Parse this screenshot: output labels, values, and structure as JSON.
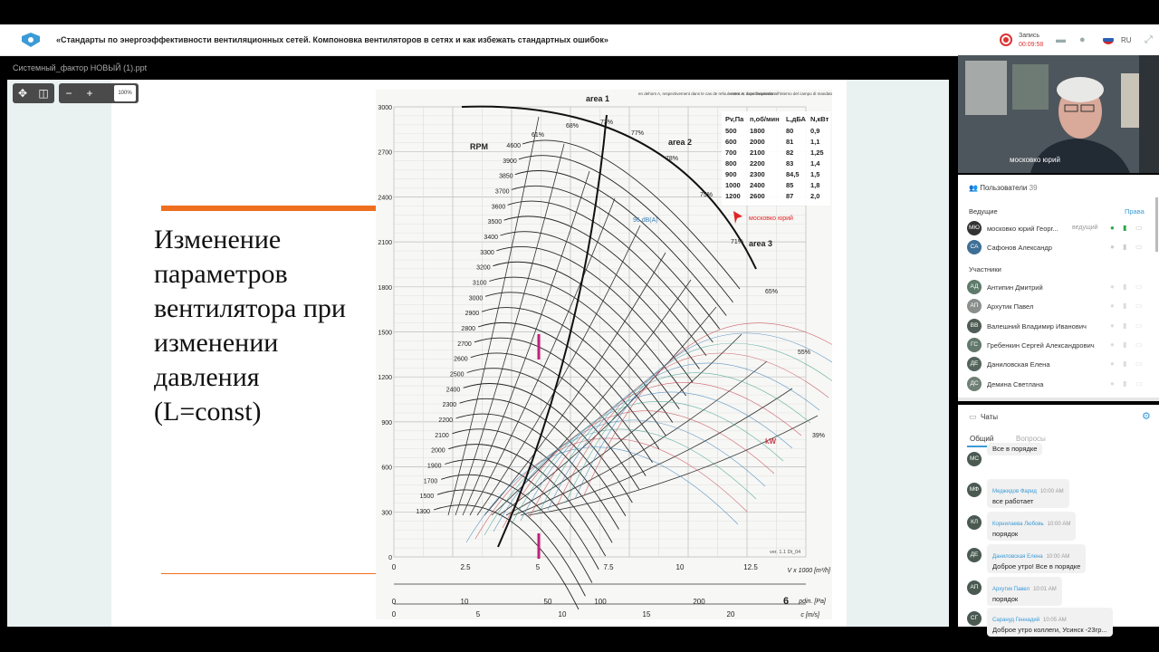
{
  "meeting": {
    "title": "«Стандарты по энергоэффективности вентиляционных сетей. Компоновка вентиляторов в сетях и как избежать стандартных ошибок»",
    "record_label": "Запись",
    "record_time": "00:09:58",
    "language": "RU"
  },
  "presentation": {
    "file_name": "Системный_фактор НОВЫЙ (1).ppt",
    "zoom": "100%",
    "slide_title": "Изменение параметров вентилятора при изменении давления (L=const)"
  },
  "chart_data": {
    "type": "line",
    "title": "",
    "y_ticks": [
      "3000",
      "2700",
      "2400",
      "2100",
      "1800",
      "1500",
      "1200",
      "900",
      "600",
      "300",
      "0"
    ],
    "x_ticks": [
      "0",
      "2.5",
      "5",
      "7.5",
      "10",
      "12.5"
    ],
    "x_unit": "V x 1000 [m³/h]",
    "pdin_ticks": [
      "0",
      "10",
      "50",
      "100",
      "200",
      "6"
    ],
    "pdin_unit": "pdin. [Pa]",
    "c_ticks": [
      "0",
      "5",
      "10",
      "15",
      "20"
    ],
    "c_unit": "c [m/s]",
    "rpm_label": "RPM",
    "rpm_values": [
      "4600",
      "3900",
      "3850",
      "3700",
      "3600",
      "3500",
      "3400",
      "3300",
      "3200",
      "3100",
      "3000",
      "2900",
      "2800",
      "2700",
      "2600",
      "2500",
      "2400",
      "2300",
      "2200",
      "2100",
      "2000",
      "1900",
      "1700",
      "1500",
      "1300"
    ],
    "efficiency_labels": [
      "61%",
      "68%",
      "73%",
      "77%",
      "78%",
      "75%",
      "71%",
      "65%",
      "55%",
      "39%"
    ],
    "area_labels": [
      "area 1",
      "area 2",
      "area 3"
    ],
    "kw_label": "kW",
    "sound_label": "96 dB(A)",
    "version_text": "ver. 1.1 Dt_04",
    "header_notes": [
      "en dehors A, respectivement dans le cas de refoulement et dans l'aspiration",
      "entro A, rispettivamente all'interno del campo di mandata e alla bocca di aspirazione"
    ],
    "table": {
      "headers": [
        "Pv,Па",
        "n,об/мин",
        "L,дБА",
        "N,кВт"
      ],
      "rows": [
        [
          "500",
          "1800",
          "80",
          "0,9"
        ],
        [
          "600",
          "2000",
          "81",
          "1,1"
        ],
        [
          "700",
          "2100",
          "82",
          "1,25"
        ],
        [
          "800",
          "2200",
          "83",
          "1,4"
        ],
        [
          "900",
          "2300",
          "84,5",
          "1,5"
        ],
        [
          "1000",
          "2400",
          "85",
          "1,8"
        ],
        [
          "1200",
          "2600",
          "87",
          "2,0"
        ]
      ]
    },
    "pointer_label": "московко юрий"
  },
  "video": {
    "name": "московко юрий"
  },
  "participants": {
    "header": "Пользователи",
    "count": "39",
    "hosts_label": "Ведущие",
    "rights_label": "Права",
    "hosts": [
      {
        "initials": "МЮ",
        "name": "московко юрий Георг...",
        "role": "ведущий"
      },
      {
        "initials": "СА",
        "name": "Сафонов Александр",
        "role": ""
      }
    ],
    "members_label": "Участники",
    "members": [
      {
        "initials": "АД",
        "name": "Антипин Дмитрий"
      },
      {
        "initials": "АП",
        "name": "Архутик Павел"
      },
      {
        "initials": "ВВ",
        "name": "Валешний Владимир Иванович"
      },
      {
        "initials": "ГС",
        "name": "Гребенкин Сергей Александрович"
      },
      {
        "initials": "ДЕ",
        "name": "Даниловская Елена"
      },
      {
        "initials": "ДС",
        "name": "Демина Светлана"
      }
    ]
  },
  "chats": {
    "header": "Чаты",
    "tabs": [
      "Общий",
      "Вопросы"
    ],
    "messages": [
      {
        "initials": "МС",
        "author": "",
        "time": "",
        "text": "Все в порядке"
      },
      {
        "initials": "МФ",
        "author": "Меджидов Фарид",
        "time": "10:00 AM",
        "text": "все работает"
      },
      {
        "initials": "КЛ",
        "author": "Корнилаева Любовь",
        "time": "10:00 AM",
        "text": "порядок"
      },
      {
        "initials": "ДЕ",
        "author": "Даниловская Елена",
        "time": "10:00 AM",
        "text": "Доброе утро! Все в порядке"
      },
      {
        "initials": "АП",
        "author": "Архутик Павел",
        "time": "10:01 AM",
        "text": "порядок"
      },
      {
        "initials": "СГ",
        "author": "Сарануд Геннадий",
        "time": "10:05 AM",
        "text": "Доброе утро коллеги, Усинск -23гр..."
      }
    ]
  }
}
